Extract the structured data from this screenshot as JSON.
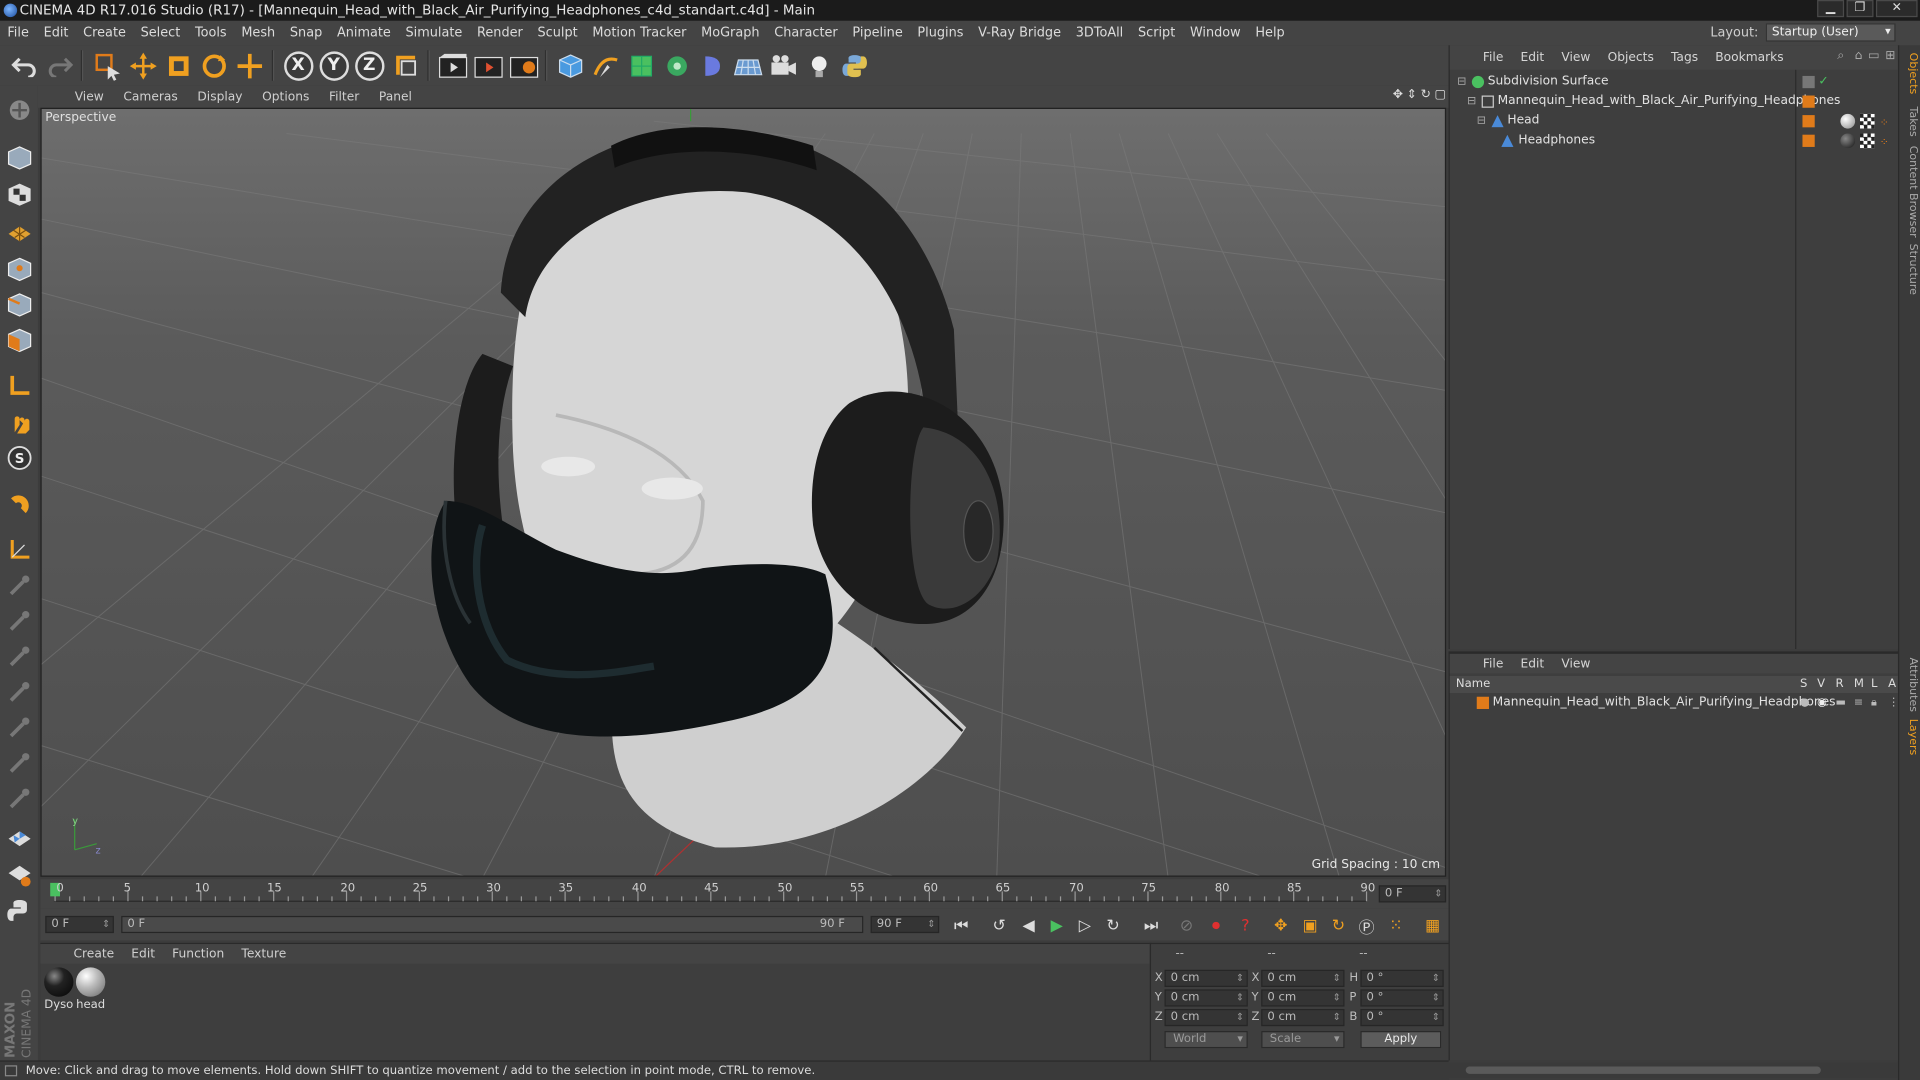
{
  "window": {
    "title": "CINEMA 4D R17.016 Studio (R17) - [Mannequin_Head_with_Black_Air_Purifying_Headphones_c4d_standart.c4d] - Main"
  },
  "menu": [
    "File",
    "Edit",
    "Create",
    "Select",
    "Tools",
    "Mesh",
    "Snap",
    "Animate",
    "Simulate",
    "Render",
    "Sculpt",
    "Motion Tracker",
    "MoGraph",
    "Character",
    "Pipeline",
    "Plugins",
    "V-Ray Bridge",
    "3DToAll",
    "Script",
    "Window",
    "Help"
  ],
  "layout": {
    "label": "Layout:",
    "value": "Startup (User)"
  },
  "toolbar": {
    "axis_x": "X",
    "axis_y": "Y",
    "axis_z": "Z"
  },
  "viewport": {
    "menu": [
      "View",
      "Cameras",
      "Display",
      "Options",
      "Filter",
      "Panel"
    ],
    "camera_label": "Perspective",
    "grid_spacing": "Grid Spacing : 10 cm"
  },
  "timeline": {
    "ticks": [
      "0",
      "5",
      "10",
      "15",
      "20",
      "25",
      "30",
      "35",
      "40",
      "45",
      "50",
      "55",
      "60",
      "65",
      "70",
      "75",
      "80",
      "85",
      "90"
    ],
    "current_frame": "0 F",
    "start_field": "0 F",
    "range_start": "0 F",
    "range_end": "90 F",
    "end_field": "90 F"
  },
  "materials": {
    "menu": [
      "Create",
      "Edit",
      "Function",
      "Texture"
    ],
    "items": [
      {
        "name": "Dyso",
        "color": "#151515"
      },
      {
        "name": "head",
        "color": "#c8c8c8"
      }
    ]
  },
  "coordinates": {
    "header": [
      "--",
      "--",
      "--"
    ],
    "rows": [
      {
        "pos_label": "X",
        "pos": "0 cm",
        "size_label": "X",
        "size": "0 cm",
        "rot_label": "H",
        "rot": "0 °"
      },
      {
        "pos_label": "Y",
        "pos": "0 cm",
        "size_label": "Y",
        "size": "0 cm",
        "rot_label": "P",
        "rot": "0 °"
      },
      {
        "pos_label": "Z",
        "pos": "0 cm",
        "size_label": "Z",
        "size": "0 cm",
        "rot_label": "B",
        "rot": "0 °"
      }
    ],
    "space": "World",
    "mode": "Scale",
    "apply": "Apply"
  },
  "status": "Move: Click and drag to move elements. Hold down SHIFT to quantize movement / add to the selection in point mode, CTRL to remove.",
  "objects": {
    "menu": [
      "File",
      "Edit",
      "View",
      "Objects",
      "Tags",
      "Bookmarks"
    ],
    "items": [
      {
        "name": "Subdivision Surface",
        "indent": 0
      },
      {
        "name": "Mannequin_Head_with_Black_Air_Purifying_Headphones",
        "indent": 1
      },
      {
        "name": "Head",
        "indent": 2
      },
      {
        "name": "Headphones",
        "indent": 3
      }
    ]
  },
  "layers": {
    "menu": [
      "File",
      "Edit",
      "View"
    ],
    "columns": {
      "name": "Name",
      "s": "S",
      "v": "V",
      "r": "R",
      "m": "M",
      "l": "L",
      "a": "A"
    },
    "items": [
      {
        "name": "Mannequin_Head_with_Black_Air_Purifying_Headphones"
      }
    ]
  },
  "side_tabs": [
    "Objects",
    "Takes",
    "Content Browser",
    "Structure",
    "Attributes",
    "Layers"
  ],
  "maxon_logo": "MAXON CINEMA 4D",
  "colors": {
    "accent_orange": "#e07b1a",
    "selection_blue": "#4a8ad8"
  }
}
